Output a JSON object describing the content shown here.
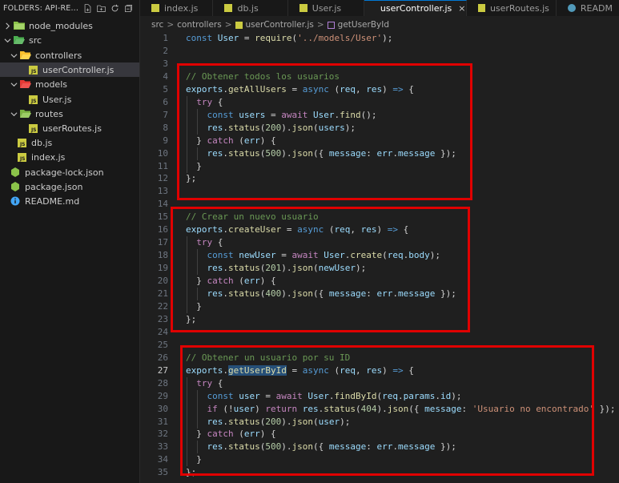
{
  "explorer": {
    "title": "FOLDERS: API-RE...",
    "items": [
      {
        "label": "node_modules"
      },
      {
        "label": "src"
      },
      {
        "label": "controllers"
      },
      {
        "label": "userController.js"
      },
      {
        "label": "models"
      },
      {
        "label": "User.js"
      },
      {
        "label": "routes"
      },
      {
        "label": "userRoutes.js"
      },
      {
        "label": "db.js"
      },
      {
        "label": "index.js"
      },
      {
        "label": "package-lock.json"
      },
      {
        "label": "package.json"
      },
      {
        "label": "README.md"
      }
    ]
  },
  "tabs": [
    {
      "label": "index.js"
    },
    {
      "label": "db.js"
    },
    {
      "label": "User.js"
    },
    {
      "label": "userController.js",
      "close": "×"
    },
    {
      "label": "userRoutes.js"
    },
    {
      "label": "READM"
    }
  ],
  "breadcrumb": [
    "src",
    "controllers",
    "userController.js",
    "getUserById"
  ],
  "breadcrumb_sep": ">",
  "editor": {
    "current_line": 27,
    "lines": [
      {
        "n": "1",
        "tokens": [
          [
            "k",
            "const "
          ],
          [
            "v",
            "User"
          ],
          [
            "p",
            " = "
          ],
          [
            "f",
            "require"
          ],
          [
            "p",
            "("
          ],
          [
            "s",
            "'../models/User'"
          ],
          [
            "p",
            ");"
          ]
        ]
      },
      {
        "n": "2",
        "tokens": []
      },
      {
        "n": "3",
        "tokens": []
      },
      {
        "n": "4",
        "tokens": [
          [
            "cm",
            "// Obtener todos los usuarios"
          ]
        ]
      },
      {
        "n": "5",
        "tokens": [
          [
            "v",
            "exports"
          ],
          [
            "p",
            "."
          ],
          [
            "f",
            "getAllUsers"
          ],
          [
            "p",
            " = "
          ],
          [
            "k",
            "async "
          ],
          [
            "p",
            "("
          ],
          [
            "v",
            "req"
          ],
          [
            "p",
            ", "
          ],
          [
            "v",
            "res"
          ],
          [
            "p",
            ") "
          ],
          [
            "k",
            "=>"
          ],
          [
            "p",
            " {"
          ]
        ]
      },
      {
        "n": "6",
        "tokens": [
          [
            "p",
            "  "
          ],
          [
            "c",
            "try"
          ],
          [
            "p",
            " {"
          ]
        ]
      },
      {
        "n": "7",
        "tokens": [
          [
            "p",
            "    "
          ],
          [
            "k",
            "const "
          ],
          [
            "v",
            "users"
          ],
          [
            "p",
            " = "
          ],
          [
            "c",
            "await "
          ],
          [
            "v",
            "User"
          ],
          [
            "p",
            "."
          ],
          [
            "f",
            "find"
          ],
          [
            "p",
            "();"
          ]
        ]
      },
      {
        "n": "8",
        "tokens": [
          [
            "p",
            "    "
          ],
          [
            "v",
            "res"
          ],
          [
            "p",
            "."
          ],
          [
            "f",
            "status"
          ],
          [
            "p",
            "("
          ],
          [
            "n",
            "200"
          ],
          [
            "p",
            ")."
          ],
          [
            "f",
            "json"
          ],
          [
            "p",
            "("
          ],
          [
            "v",
            "users"
          ],
          [
            "p",
            ");"
          ]
        ]
      },
      {
        "n": "9",
        "tokens": [
          [
            "p",
            "  } "
          ],
          [
            "c",
            "catch"
          ],
          [
            "p",
            " ("
          ],
          [
            "v",
            "err"
          ],
          [
            "p",
            ") {"
          ]
        ]
      },
      {
        "n": "10",
        "tokens": [
          [
            "p",
            "    "
          ],
          [
            "v",
            "res"
          ],
          [
            "p",
            "."
          ],
          [
            "f",
            "status"
          ],
          [
            "p",
            "("
          ],
          [
            "n",
            "500"
          ],
          [
            "p",
            ")."
          ],
          [
            "f",
            "json"
          ],
          [
            "p",
            "({ "
          ],
          [
            "v",
            "message"
          ],
          [
            "p",
            ": "
          ],
          [
            "v",
            "err"
          ],
          [
            "p",
            "."
          ],
          [
            "v",
            "message"
          ],
          [
            "p",
            " });"
          ]
        ]
      },
      {
        "n": "11",
        "tokens": [
          [
            "p",
            "  }"
          ]
        ]
      },
      {
        "n": "12",
        "tokens": [
          [
            "p",
            "};"
          ]
        ]
      },
      {
        "n": "13",
        "tokens": []
      },
      {
        "n": "14",
        "tokens": []
      },
      {
        "n": "15",
        "tokens": [
          [
            "cm",
            "// Crear un nuevo usuario"
          ]
        ]
      },
      {
        "n": "16",
        "tokens": [
          [
            "v",
            "exports"
          ],
          [
            "p",
            "."
          ],
          [
            "f",
            "createUser"
          ],
          [
            "p",
            " = "
          ],
          [
            "k",
            "async "
          ],
          [
            "p",
            "("
          ],
          [
            "v",
            "req"
          ],
          [
            "p",
            ", "
          ],
          [
            "v",
            "res"
          ],
          [
            "p",
            ") "
          ],
          [
            "k",
            "=>"
          ],
          [
            "p",
            " {"
          ]
        ]
      },
      {
        "n": "17",
        "tokens": [
          [
            "p",
            "  "
          ],
          [
            "c",
            "try"
          ],
          [
            "p",
            " {"
          ]
        ]
      },
      {
        "n": "18",
        "tokens": [
          [
            "p",
            "    "
          ],
          [
            "k",
            "const "
          ],
          [
            "v",
            "newUser"
          ],
          [
            "p",
            " = "
          ],
          [
            "c",
            "await "
          ],
          [
            "v",
            "User"
          ],
          [
            "p",
            "."
          ],
          [
            "f",
            "create"
          ],
          [
            "p",
            "("
          ],
          [
            "v",
            "req"
          ],
          [
            "p",
            "."
          ],
          [
            "v",
            "body"
          ],
          [
            "p",
            ");"
          ]
        ]
      },
      {
        "n": "19",
        "tokens": [
          [
            "p",
            "    "
          ],
          [
            "v",
            "res"
          ],
          [
            "p",
            "."
          ],
          [
            "f",
            "status"
          ],
          [
            "p",
            "("
          ],
          [
            "n",
            "201"
          ],
          [
            "p",
            ")."
          ],
          [
            "f",
            "json"
          ],
          [
            "p",
            "("
          ],
          [
            "v",
            "newUser"
          ],
          [
            "p",
            ");"
          ]
        ]
      },
      {
        "n": "20",
        "tokens": [
          [
            "p",
            "  } "
          ],
          [
            "c",
            "catch"
          ],
          [
            "p",
            " ("
          ],
          [
            "v",
            "err"
          ],
          [
            "p",
            ") {"
          ]
        ]
      },
      {
        "n": "21",
        "tokens": [
          [
            "p",
            "    "
          ],
          [
            "v",
            "res"
          ],
          [
            "p",
            "."
          ],
          [
            "f",
            "status"
          ],
          [
            "p",
            "("
          ],
          [
            "n",
            "400"
          ],
          [
            "p",
            ")."
          ],
          [
            "f",
            "json"
          ],
          [
            "p",
            "({ "
          ],
          [
            "v",
            "message"
          ],
          [
            "p",
            ": "
          ],
          [
            "v",
            "err"
          ],
          [
            "p",
            "."
          ],
          [
            "v",
            "message"
          ],
          [
            "p",
            " });"
          ]
        ]
      },
      {
        "n": "22",
        "tokens": [
          [
            "p",
            "  }"
          ]
        ]
      },
      {
        "n": "23",
        "tokens": [
          [
            "p",
            "};"
          ]
        ]
      },
      {
        "n": "24",
        "tokens": []
      },
      {
        "n": "25",
        "tokens": []
      },
      {
        "n": "26",
        "tokens": [
          [
            "cm",
            "// Obtener un usuario por su ID"
          ]
        ]
      },
      {
        "n": "27",
        "tokens": [
          [
            "v",
            "exports"
          ],
          [
            "p",
            "."
          ],
          [
            "fh",
            "getUserById"
          ],
          [
            "p",
            " = "
          ],
          [
            "k",
            "async "
          ],
          [
            "p",
            "("
          ],
          [
            "v",
            "req"
          ],
          [
            "p",
            ", "
          ],
          [
            "v",
            "res"
          ],
          [
            "p",
            ") "
          ],
          [
            "k",
            "=>"
          ],
          [
            "p",
            " {"
          ]
        ]
      },
      {
        "n": "28",
        "tokens": [
          [
            "p",
            "  "
          ],
          [
            "c",
            "try"
          ],
          [
            "p",
            " {"
          ]
        ]
      },
      {
        "n": "29",
        "tokens": [
          [
            "p",
            "    "
          ],
          [
            "k",
            "const "
          ],
          [
            "v",
            "user"
          ],
          [
            "p",
            " = "
          ],
          [
            "c",
            "await "
          ],
          [
            "v",
            "User"
          ],
          [
            "p",
            "."
          ],
          [
            "f",
            "findById"
          ],
          [
            "p",
            "("
          ],
          [
            "v",
            "req"
          ],
          [
            "p",
            "."
          ],
          [
            "v",
            "params"
          ],
          [
            "p",
            "."
          ],
          [
            "v",
            "id"
          ],
          [
            "p",
            ");"
          ]
        ]
      },
      {
        "n": "30",
        "tokens": [
          [
            "p",
            "    "
          ],
          [
            "c",
            "if"
          ],
          [
            "p",
            " (!"
          ],
          [
            "v",
            "user"
          ],
          [
            "p",
            ") "
          ],
          [
            "c",
            "return "
          ],
          [
            "v",
            "res"
          ],
          [
            "p",
            "."
          ],
          [
            "f",
            "status"
          ],
          [
            "p",
            "("
          ],
          [
            "n",
            "404"
          ],
          [
            "p",
            ")."
          ],
          [
            "f",
            "json"
          ],
          [
            "p",
            "({ "
          ],
          [
            "v",
            "message"
          ],
          [
            "p",
            ": "
          ],
          [
            "s",
            "'Usuario no encontrado'"
          ],
          [
            "p",
            " });"
          ]
        ]
      },
      {
        "n": "31",
        "tokens": [
          [
            "p",
            "    "
          ],
          [
            "v",
            "res"
          ],
          [
            "p",
            "."
          ],
          [
            "f",
            "status"
          ],
          [
            "p",
            "("
          ],
          [
            "n",
            "200"
          ],
          [
            "p",
            ")."
          ],
          [
            "f",
            "json"
          ],
          [
            "p",
            "("
          ],
          [
            "v",
            "user"
          ],
          [
            "p",
            ");"
          ]
        ]
      },
      {
        "n": "32",
        "tokens": [
          [
            "p",
            "  } "
          ],
          [
            "c",
            "catch"
          ],
          [
            "p",
            " ("
          ],
          [
            "v",
            "err"
          ],
          [
            "p",
            ") {"
          ]
        ]
      },
      {
        "n": "33",
        "tokens": [
          [
            "p",
            "    "
          ],
          [
            "v",
            "res"
          ],
          [
            "p",
            "."
          ],
          [
            "f",
            "status"
          ],
          [
            "p",
            "("
          ],
          [
            "n",
            "500"
          ],
          [
            "p",
            ")."
          ],
          [
            "f",
            "json"
          ],
          [
            "p",
            "({ "
          ],
          [
            "v",
            "message"
          ],
          [
            "p",
            ": "
          ],
          [
            "v",
            "err"
          ],
          [
            "p",
            "."
          ],
          [
            "v",
            "message"
          ],
          [
            "p",
            " });"
          ]
        ]
      },
      {
        "n": "34",
        "tokens": [
          [
            "p",
            "  }"
          ]
        ]
      },
      {
        "n": "35",
        "tokens": [
          [
            "p",
            "};"
          ]
        ]
      }
    ]
  },
  "colors": {
    "highlight_box": "#e00000",
    "active_tab_border": "#0078d4",
    "editor_background": "#1f1f1f"
  }
}
